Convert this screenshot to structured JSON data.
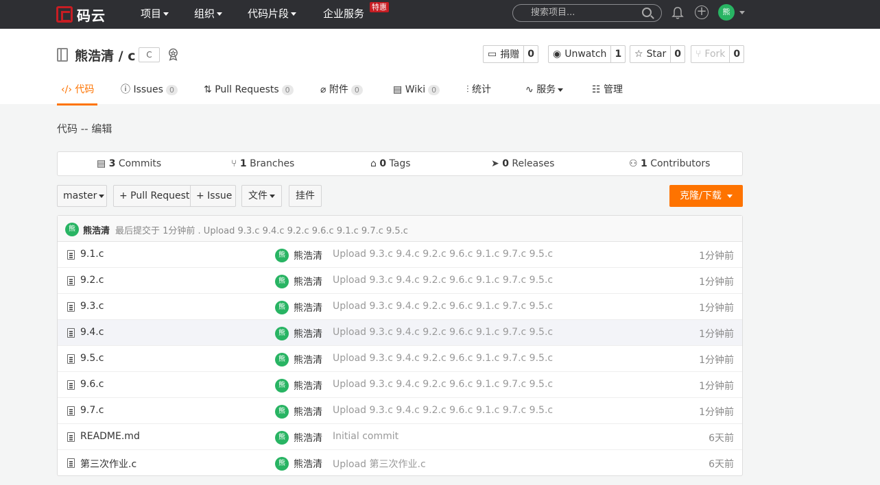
{
  "topnav": {
    "logo_text": "码云",
    "items": [
      {
        "label": "项目"
      },
      {
        "label": "组织"
      },
      {
        "label": "代码片段"
      },
      {
        "label": "企业服务"
      }
    ],
    "badge": "特惠",
    "search_placeholder": "搜索项目...",
    "avatar_text": "熊"
  },
  "repo": {
    "owner": "熊浩清",
    "name": "c",
    "lang_tag": "C",
    "actions": {
      "donate": {
        "label": "捐赠",
        "count": "0"
      },
      "watch": {
        "label": "Unwatch",
        "count": "1"
      },
      "star": {
        "label": "Star",
        "count": "0"
      },
      "fork": {
        "label": "Fork",
        "count": "0"
      }
    }
  },
  "tabs": [
    {
      "label": "代码"
    },
    {
      "label": "Issues",
      "count": "0"
    },
    {
      "label": "Pull Requests",
      "count": "0"
    },
    {
      "label": "附件",
      "count": "0"
    },
    {
      "label": "Wiki",
      "count": "0"
    },
    {
      "label": "统计"
    },
    {
      "label": "服务"
    },
    {
      "label": "管理"
    }
  ],
  "page_title": "代码 -- 编辑",
  "stats": {
    "commits": {
      "count": "3",
      "label": "Commits"
    },
    "branches": {
      "count": "1",
      "label": "Branches"
    },
    "tags": {
      "count": "0",
      "label": "Tags"
    },
    "releases": {
      "count": "0",
      "label": "Releases"
    },
    "contributors": {
      "count": "1",
      "label": "Contributors"
    }
  },
  "toolbar": {
    "branch": "master",
    "pull_request": "+ Pull Request",
    "issue": "+ Issue",
    "file": "文件",
    "widget": "挂件",
    "clone": "克隆/下载"
  },
  "last_commit": {
    "author": "熊浩清",
    "text": "最后提交于 1分钟前 . Upload 9.3.c 9.4.c 9.2.c 9.6.c 9.1.c 9.7.c 9.5.c"
  },
  "files": [
    {
      "name": "9.1.c",
      "author": "熊浩清",
      "message": "Upload 9.3.c 9.4.c 9.2.c 9.6.c 9.1.c 9.7.c 9.5.c",
      "time": "1分钟前"
    },
    {
      "name": "9.2.c",
      "author": "熊浩清",
      "message": "Upload 9.3.c 9.4.c 9.2.c 9.6.c 9.1.c 9.7.c 9.5.c",
      "time": "1分钟前"
    },
    {
      "name": "9.3.c",
      "author": "熊浩清",
      "message": "Upload 9.3.c 9.4.c 9.2.c 9.6.c 9.1.c 9.7.c 9.5.c",
      "time": "1分钟前"
    },
    {
      "name": "9.4.c",
      "author": "熊浩清",
      "message": "Upload 9.3.c 9.4.c 9.2.c 9.6.c 9.1.c 9.7.c 9.5.c",
      "time": "1分钟前"
    },
    {
      "name": "9.5.c",
      "author": "熊浩清",
      "message": "Upload 9.3.c 9.4.c 9.2.c 9.6.c 9.1.c 9.7.c 9.5.c",
      "time": "1分钟前"
    },
    {
      "name": "9.6.c",
      "author": "熊浩清",
      "message": "Upload 9.3.c 9.4.c 9.2.c 9.6.c 9.1.c 9.7.c 9.5.c",
      "time": "1分钟前"
    },
    {
      "name": "9.7.c",
      "author": "熊浩清",
      "message": "Upload 9.3.c 9.4.c 9.2.c 9.6.c 9.1.c 9.7.c 9.5.c",
      "time": "1分钟前"
    },
    {
      "name": "README.md",
      "author": "熊浩清",
      "message": "Initial commit",
      "time": "6天前"
    },
    {
      "name": "第三次作业.c",
      "author": "熊浩清",
      "message": "Upload 第三次作业.c",
      "time": "6天前"
    }
  ],
  "colors": {
    "accent": "#fe7300",
    "nav_bg": "#2e2f33",
    "avatar": "#28b463",
    "brand_red": "#c71d23"
  }
}
